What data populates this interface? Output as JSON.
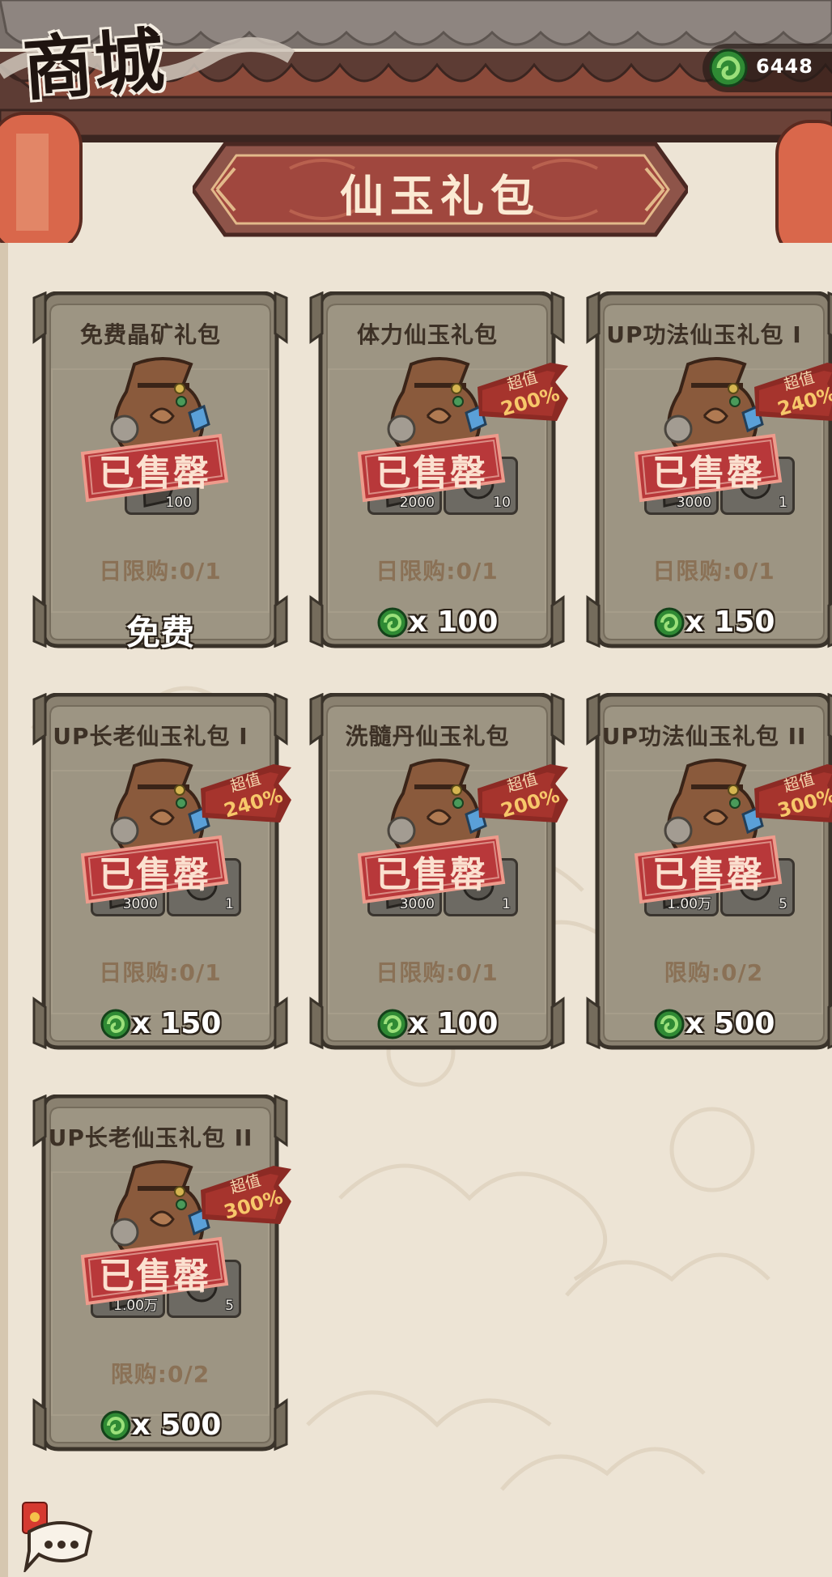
{
  "header": {
    "title": "商城",
    "currency": {
      "icon": "jade-coin-icon",
      "amount": "6448"
    },
    "banner_title": "仙玉礼包"
  },
  "packs": [
    {
      "name": "免费晶矿礼包",
      "badge": null,
      "items": [
        "100"
      ],
      "limit": "日限购:0/1",
      "price": "免费",
      "free": true,
      "sold_out": "已售罄"
    },
    {
      "name": "体力仙玉礼包",
      "badge": {
        "label": "超值",
        "value": "200%"
      },
      "items": [
        "2000",
        "10"
      ],
      "limit": "日限购:0/1",
      "price": "x 100",
      "free": false,
      "sold_out": "已售罄"
    },
    {
      "name": "UP功法仙玉礼包 I",
      "badge": {
        "label": "超值",
        "value": "240%"
      },
      "items": [
        "3000",
        "1"
      ],
      "limit": "日限购:0/1",
      "price": "x 150",
      "free": false,
      "sold_out": "已售罄"
    },
    {
      "name": "UP长老仙玉礼包 I",
      "badge": {
        "label": "超值",
        "value": "240%"
      },
      "items": [
        "3000",
        "1"
      ],
      "limit": "日限购:0/1",
      "price": "x 150",
      "free": false,
      "sold_out": "已售罄"
    },
    {
      "name": "洗髓丹仙玉礼包",
      "badge": {
        "label": "超值",
        "value": "200%"
      },
      "items": [
        "3000",
        "1"
      ],
      "limit": "日限购:0/1",
      "price": "x 100",
      "free": false,
      "sold_out": "已售罄"
    },
    {
      "name": "UP功法仙玉礼包 II",
      "badge": {
        "label": "超值",
        "value": "300%"
      },
      "items": [
        "1.00万",
        "5"
      ],
      "limit": "限购:0/2",
      "price": "x 500",
      "free": false,
      "sold_out": "已售罄"
    },
    {
      "name": "UP长老仙玉礼包 II",
      "badge": {
        "label": "超值",
        "value": "300%"
      },
      "items": [
        "1.00万",
        "5"
      ],
      "limit": "限购:0/2",
      "price": "x 500",
      "free": false,
      "sold_out": "已售罄"
    }
  ],
  "colors": {
    "card_bg": "#8a8170",
    "sold_red": "#b8383a",
    "accent_green": "#3a9a3a"
  },
  "footer": {
    "chat_icon": "chat-bubble-icon",
    "red_packet_icon": "red-envelope-icon"
  }
}
